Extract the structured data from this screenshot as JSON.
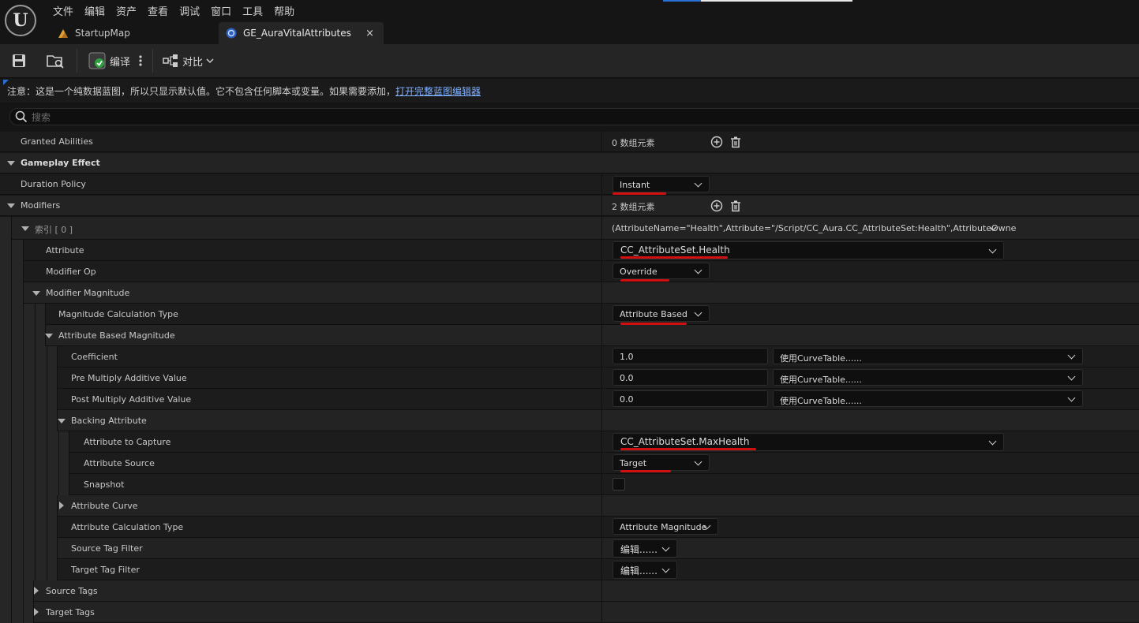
{
  "menu": [
    "文件",
    "编辑",
    "资产",
    "查看",
    "调试",
    "窗口",
    "工具",
    "帮助"
  ],
  "tabs": [
    {
      "label": "StartupMap",
      "icon": "map-icon"
    },
    {
      "label": "GE_AuraVitalAttributes",
      "icon": "blueprint-icon",
      "close": "×"
    }
  ],
  "toolbar": {
    "compile": "编译",
    "diff": "对比"
  },
  "notice": {
    "text": "注意：这是一个纯数据蓝图，所以只显示默认值。它不包含任何脚本或变量。如果需要添加，",
    "link": "打开完整蓝图编辑器"
  },
  "search": {
    "placeholder": "搜索"
  },
  "rows": {
    "granted_abilities": {
      "label": "Granted Abilities",
      "value": "0 数组元素"
    },
    "gameplay_effect": {
      "label": "Gameplay Effect"
    },
    "duration_policy": {
      "label": "Duration Policy",
      "value": "Instant"
    },
    "modifiers": {
      "label": "Modifiers",
      "value": "2 数组元素"
    },
    "index0": {
      "label": "索引 [ 0 ]",
      "value": "(AttributeName=\"Health\",Attribute=\"/Script/CC_Aura.CC_AttributeSet:Health\",AttributeOwne"
    },
    "attribute": {
      "label": "Attribute",
      "value": "CC_AttributeSet.Health"
    },
    "modifier_op": {
      "label": "Modifier Op",
      "value": "Override"
    },
    "modifier_magnitude": {
      "label": "Modifier Magnitude"
    },
    "magnitude_calc_type": {
      "label": "Magnitude Calculation Type",
      "value": "Attribute Based"
    },
    "attribute_based_magnitude": {
      "label": "Attribute Based Magnitude"
    },
    "coefficient": {
      "label": "Coefficient",
      "value": "1.0",
      "curve": "使用CurveTable......"
    },
    "pre_multiply": {
      "label": "Pre Multiply Additive Value",
      "value": "0.0",
      "curve": "使用CurveTable......"
    },
    "post_multiply": {
      "label": "Post Multiply Additive Value",
      "value": "0.0",
      "curve": "使用CurveTable......"
    },
    "backing_attribute": {
      "label": "Backing Attribute"
    },
    "attribute_to_capture": {
      "label": "Attribute to Capture",
      "value": "CC_AttributeSet.MaxHealth"
    },
    "attribute_source": {
      "label": "Attribute Source",
      "value": "Target"
    },
    "snapshot": {
      "label": "Snapshot",
      "checked": false
    },
    "attribute_curve": {
      "label": "Attribute Curve"
    },
    "attribute_calc_type": {
      "label": "Attribute Calculation Type",
      "value": "Attribute Magnitude"
    },
    "source_tag_filter": {
      "label": "Source Tag Filter",
      "value": "编辑......"
    },
    "target_tag_filter": {
      "label": "Target Tag Filter",
      "value": "编辑......"
    },
    "source_tags": {
      "label": "Source Tags"
    },
    "target_tags": {
      "label": "Target Tags"
    }
  },
  "colors": {
    "background": "#151515",
    "panel": "#1c1c1c",
    "link": "#7fb0ff",
    "annotation": "#d01010",
    "accent": "#2a6fd6"
  }
}
